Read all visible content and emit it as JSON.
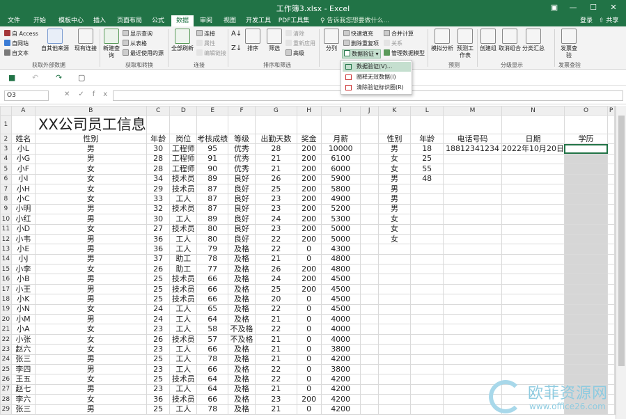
{
  "window": {
    "title": "工作簿3.xlsx - Excel",
    "controls": [
      "▣",
      "—",
      "☐",
      "✕"
    ]
  },
  "tabs": [
    "文件",
    "开始",
    "模板中心",
    "插入",
    "页面布局",
    "公式",
    "数据",
    "审阅",
    "视图",
    "开发工具",
    "PDF工具集"
  ],
  "tell_me": "♀ 告诉我您想要做什么...",
  "account": {
    "login": "登录",
    "share": "⇧ 共享"
  },
  "ribbon": {
    "get_external": {
      "access": "自 Access",
      "web": "自网站",
      "text": "自文本",
      "other": "自其他来源",
      "existing": "现有连接",
      "label": "获取外部数据"
    },
    "get_transform": {
      "new_query": "新建查询",
      "show_queries": "显示查询",
      "from_table": "从表格",
      "recent": "最近使用的源",
      "label": "获取和转换"
    },
    "connections": {
      "refresh_all": "全部刷新",
      "connections": "连接",
      "properties": "属性",
      "edit_links": "编辑链接",
      "label": "连接"
    },
    "sort_filter": {
      "sort": "排序",
      "filter": "筛选",
      "clear": "清除",
      "reapply": "重新应用",
      "advanced": "高级",
      "label": "排序和筛选"
    },
    "data_tools": {
      "text_to_columns": "分列",
      "flash_fill": "快速填充",
      "remove_dup": "删除重复项",
      "validation": "数据验证",
      "consolidate": "合并计算",
      "relationships": "关系",
      "data_model": "管理数据模型"
    },
    "forecast": {
      "whatif": "模拟分析",
      "forecast_sheet": "预测工作表",
      "label": "预测"
    },
    "outline": {
      "group": "创建组",
      "ungroup": "取消组合",
      "subtotal": "分类汇总",
      "label": "分级显示"
    },
    "invoice": {
      "check": "发票查验",
      "label": "发票查验"
    }
  },
  "validation_menu": [
    "数据验证(V)...",
    "圈释无效数据(I)",
    "清除验证标识圈(R)"
  ],
  "formula_bar": {
    "name_box": "O3",
    "fx": "fx",
    "formula": ""
  },
  "columns": [
    "A",
    "B",
    "C",
    "D",
    "E",
    "F",
    "G",
    "H",
    "I",
    "J",
    "K",
    "L",
    "M",
    "N",
    "O",
    "P"
  ],
  "sheet_title": "XX公司员工信息",
  "headers": [
    "姓名",
    "性别",
    "年龄",
    "岗位",
    "考核成绩",
    "等级",
    "出勤天数",
    "奖金",
    "月薪"
  ],
  "rows": [
    [
      "小L",
      "男",
      "30",
      "工程师",
      "95",
      "优秀",
      "28",
      "200",
      "10000"
    ],
    [
      "小G",
      "男",
      "28",
      "工程师",
      "91",
      "优秀",
      "21",
      "200",
      "6100"
    ],
    [
      "小F",
      "女",
      "28",
      "工程师",
      "90",
      "优秀",
      "21",
      "200",
      "6000"
    ],
    [
      "小I",
      "女",
      "34",
      "技术员",
      "89",
      "良好",
      "26",
      "200",
      "5900"
    ],
    [
      "小H",
      "女",
      "29",
      "技术员",
      "87",
      "良好",
      "25",
      "200",
      "5800"
    ],
    [
      "小C",
      "女",
      "33",
      "工人",
      "87",
      "良好",
      "23",
      "200",
      "4900"
    ],
    [
      "小明",
      "男",
      "32",
      "技术员",
      "87",
      "良好",
      "23",
      "200",
      "5200"
    ],
    [
      "小红",
      "男",
      "30",
      "工人",
      "89",
      "良好",
      "24",
      "200",
      "5300"
    ],
    [
      "小D",
      "女",
      "27",
      "技术员",
      "80",
      "良好",
      "23",
      "200",
      "5000"
    ],
    [
      "小韦",
      "男",
      "36",
      "工人",
      "80",
      "良好",
      "22",
      "200",
      "5000"
    ],
    [
      "小E",
      "男",
      "36",
      "工人",
      "79",
      "及格",
      "22",
      "0",
      "4300"
    ],
    [
      "小J",
      "男",
      "37",
      "助工",
      "78",
      "及格",
      "21",
      "0",
      "4800"
    ],
    [
      "小李",
      "女",
      "26",
      "助工",
      "77",
      "及格",
      "26",
      "200",
      "4800"
    ],
    [
      "小B",
      "男",
      "25",
      "技术员",
      "66",
      "及格",
      "24",
      "200",
      "4500"
    ],
    [
      "小王",
      "男",
      "25",
      "技术员",
      "66",
      "及格",
      "25",
      "200",
      "4500"
    ],
    [
      "小K",
      "男",
      "25",
      "技术员",
      "66",
      "及格",
      "20",
      "0",
      "4500"
    ],
    [
      "小N",
      "女",
      "24",
      "工人",
      "65",
      "及格",
      "22",
      "0",
      "4500"
    ],
    [
      "小M",
      "男",
      "24",
      "工人",
      "64",
      "及格",
      "21",
      "0",
      "4000"
    ],
    [
      "小A",
      "女",
      "23",
      "工人",
      "58",
      "不及格",
      "22",
      "0",
      "4000"
    ],
    [
      "小张",
      "女",
      "26",
      "技术员",
      "57",
      "不及格",
      "21",
      "0",
      "4000"
    ],
    [
      "赵六",
      "女",
      "23",
      "工人",
      "66",
      "及格",
      "21",
      "0",
      "3800"
    ],
    [
      "张三",
      "男",
      "25",
      "工人",
      "78",
      "及格",
      "21",
      "0",
      "4200"
    ],
    [
      "李四",
      "男",
      "23",
      "工人",
      "66",
      "及格",
      "22",
      "0",
      "3800"
    ],
    [
      "王五",
      "女",
      "25",
      "技术员",
      "64",
      "及格",
      "22",
      "0",
      "4200"
    ],
    [
      "赵七",
      "男",
      "23",
      "工人",
      "64",
      "及格",
      "21",
      "0",
      "4200"
    ],
    [
      "李六",
      "女",
      "36",
      "技术员",
      "66",
      "及格",
      "23",
      "200",
      "4200"
    ],
    [
      "张三",
      "男",
      "25",
      "工人",
      "78",
      "及格",
      "21",
      "0",
      "4200"
    ]
  ],
  "side_headers": [
    "性别",
    "年龄",
    "电话号码",
    "日期",
    "学历"
  ],
  "side_rows": [
    [
      "男",
      "18",
      "18812341234",
      "2022年10月20日"
    ],
    [
      "女",
      "25",
      "",
      ""
    ],
    [
      "女",
      "55",
      "",
      ""
    ],
    [
      "男",
      "48",
      "",
      ""
    ],
    [
      "男",
      "",
      "",
      ""
    ],
    [
      "男",
      "",
      "",
      ""
    ],
    [
      "男",
      "",
      "",
      ""
    ],
    [
      "女",
      "",
      "",
      ""
    ],
    [
      "女",
      "",
      "",
      ""
    ],
    [
      "女",
      "",
      "",
      ""
    ]
  ],
  "watermark": {
    "text": "欧菲资源网",
    "url": "www.office26.com"
  },
  "colors": {
    "brand": "#217346",
    "selection": "#d6d6d6",
    "menu_highlight": "#c5dfcf"
  }
}
